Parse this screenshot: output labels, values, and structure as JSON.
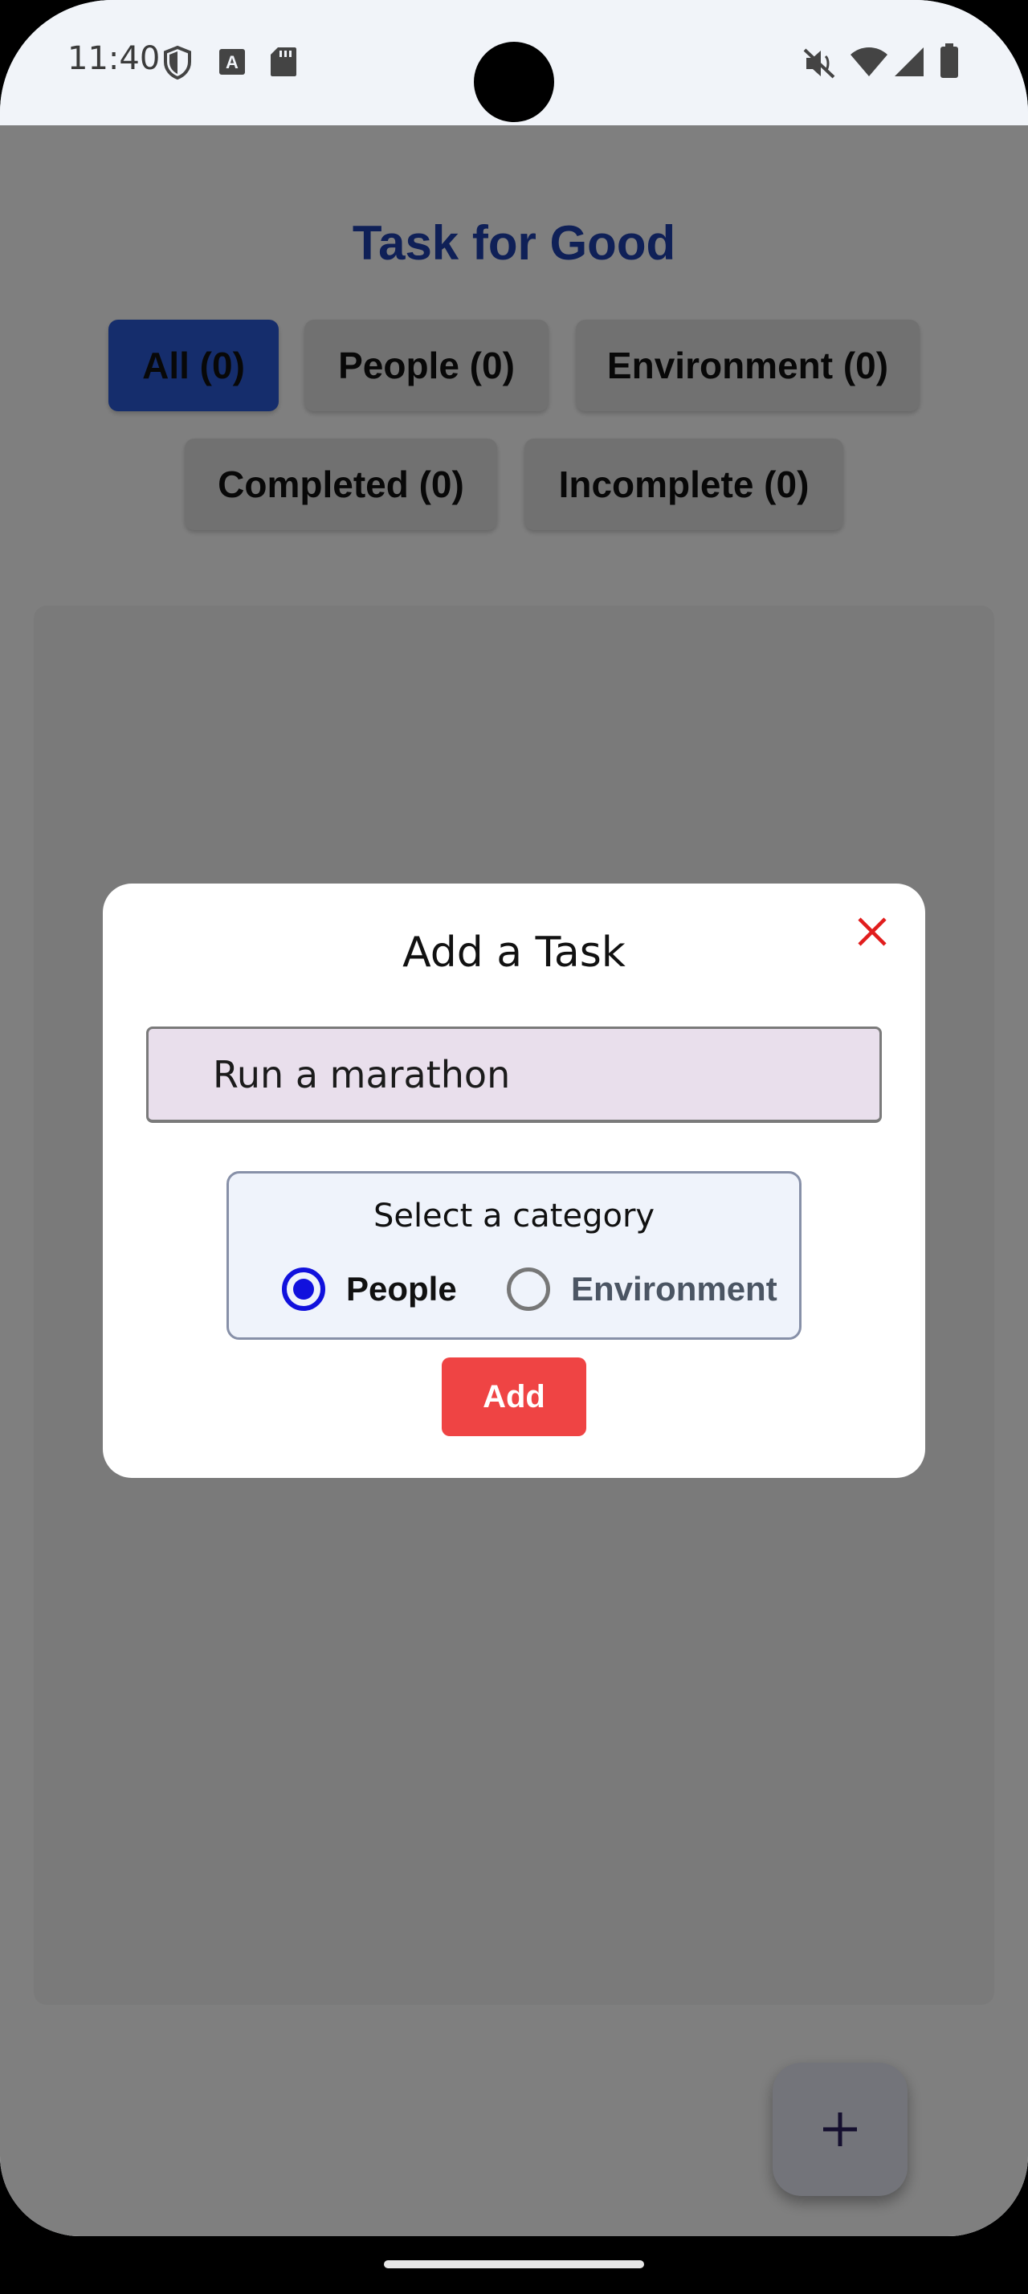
{
  "status_bar": {
    "time": "11:40",
    "left_icons": [
      "shield-icon",
      "font-download-icon",
      "sd-card-icon"
    ],
    "right_icons": [
      "mute-icon",
      "wifi-icon",
      "signal-icon",
      "battery-icon"
    ]
  },
  "app": {
    "title": "Task for Good",
    "title_color": "#1e40af",
    "filters_row1": [
      {
        "label": "All (0)",
        "active": true
      },
      {
        "label": "People (0)",
        "active": false
      },
      {
        "label": "Environment (0)",
        "active": false
      }
    ],
    "filters_row2": [
      {
        "label": "Completed (0)",
        "active": false
      },
      {
        "label": "Incomplete (0)",
        "active": false
      }
    ],
    "fab_icon": "plus-icon"
  },
  "modal": {
    "title": "Add a Task",
    "close_icon": "close-icon",
    "close_color": "#e11d1d",
    "task_input_value": "Run a marathon",
    "category": {
      "label": "Select a category",
      "options": [
        {
          "label": "People",
          "selected": true
        },
        {
          "label": "Environment",
          "selected": false
        }
      ]
    },
    "add_button_label": "Add",
    "add_button_color": "#ef4444"
  }
}
